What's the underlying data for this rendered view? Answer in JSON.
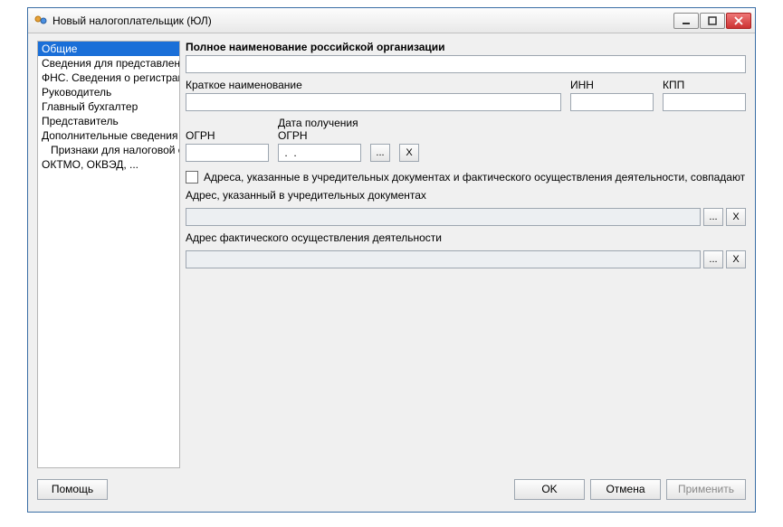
{
  "window": {
    "title": "Новый налогоплательщик (ЮЛ)"
  },
  "sidebar": {
    "items": [
      {
        "label": "Общие",
        "selected": true
      },
      {
        "label": "Сведения для представления"
      },
      {
        "label": "ФНС. Сведения о регистрации"
      },
      {
        "label": "Руководитель"
      },
      {
        "label": "Главный бухгалтер"
      },
      {
        "label": "Представитель"
      },
      {
        "label": "Дополнительные сведения"
      },
      {
        "label": "Признаки для налоговой отчетности",
        "indent": true
      },
      {
        "label": "ОКТМО, ОКВЭД, ..."
      }
    ]
  },
  "form": {
    "fullname_label": "Полное наименование российской организации",
    "fullname_value": "",
    "shortname_label": "Краткое наименование",
    "shortname_value": "",
    "inn_label": "ИНН",
    "inn_value": "",
    "kpp_label": "КПП",
    "kpp_value": "",
    "ogrn_label": "ОГРН",
    "ogrn_value": "",
    "ogrn_date_label": "Дата получения ОГРН",
    "ogrn_date_value": " .  .    ",
    "ellipsis": "...",
    "x": "X",
    "addresses_same_label": "Адреса, указанные в учредительных документах и фактического осуществления деятельности, совпадают",
    "legal_addr_label": "Адрес, указанный в учредительных документах",
    "legal_addr_value": "",
    "actual_addr_label": "Адрес фактического осуществления деятельности",
    "actual_addr_value": ""
  },
  "buttons": {
    "help": "Помощь",
    "ok": "OK",
    "cancel": "Отмена",
    "apply": "Применить"
  }
}
